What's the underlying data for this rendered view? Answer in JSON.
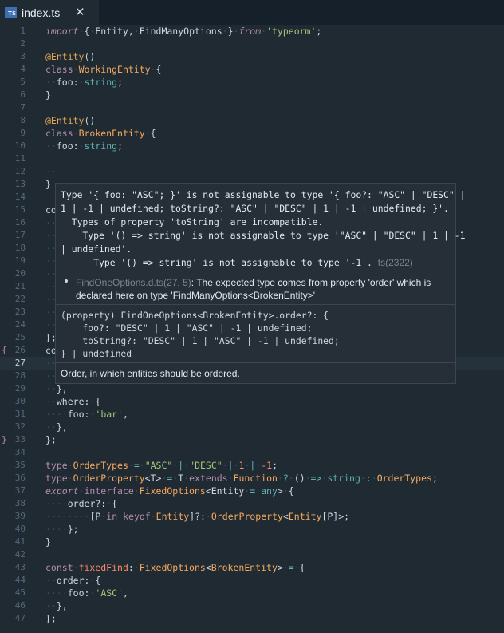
{
  "tab": {
    "title": "index.ts",
    "icon": "TS",
    "close": "✕"
  },
  "problem": {
    "lines": [
      "Type '{ foo: \"ASC\"; }' is not assignable to type '{ foo?: \"ASC\" | \"DESC\" |",
      "1 | -1 | undefined; toString?: \"ASC\" | \"DESC\" | 1 | -1 | undefined; }'.",
      "  Types of property 'toString' are incompatible.",
      "    Type '() => string' is not assignable to type '\"ASC\" | \"DESC\" | 1 | -1",
      "| undefined'.",
      "      Type '() => string' is not assignable to type '-1'."
    ],
    "code": "ts(2322)",
    "related_file": "FindOneOptions.d.ts(27, 5)",
    "related_msg": ": The expected type comes from property 'order' which is declared here on type 'FindManyOptions<BrokenEntity>'",
    "signature_head": "(property) FindOneOptions<BrokenEntity>.order?: {",
    "signature_foo": "    foo?: \"DESC\" | 1 | \"ASC\" | -1 | undefined;",
    "signature_tostring": "    toString?: \"DESC\" | 1 | \"ASC\" | -1 | undefined;",
    "signature_tail": "} | undefined",
    "doc": "Order, in which entities should be ordered."
  },
  "line_numbers": [
    "1",
    "2",
    "3",
    "4",
    "5",
    "6",
    "7",
    "8",
    "9",
    "10",
    "11",
    "12",
    "13",
    "14",
    "15",
    "16",
    "17",
    "18",
    "19",
    "20",
    "21",
    "22",
    "23",
    "24",
    "25",
    "26",
    "27",
    "28",
    "29",
    "30",
    "31",
    "32",
    "33",
    "34",
    "35",
    "36",
    "37",
    "38",
    "39",
    "40",
    "41",
    "42",
    "43",
    "44",
    "45",
    "46",
    "47"
  ],
  "current_line": "27",
  "code_peeks": {
    "l13": "}",
    "l15": "co",
    "l25": "};",
    "l26": "co"
  }
}
